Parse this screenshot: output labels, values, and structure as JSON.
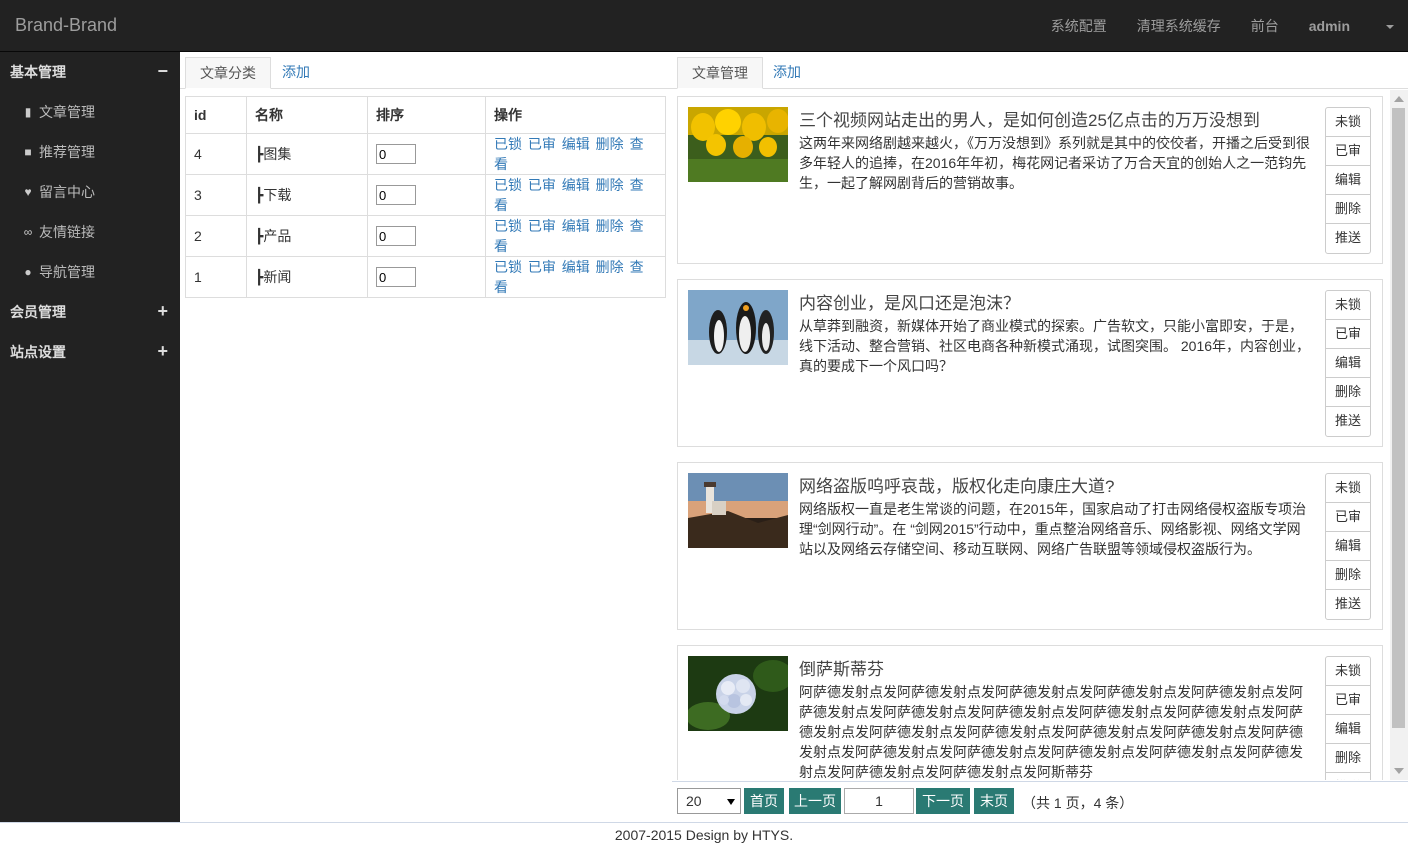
{
  "navbar": {
    "brand": "Brand-Brand",
    "links": [
      "系统配置",
      "清理系统缓存",
      "前台"
    ],
    "user": "admin"
  },
  "sidebar": {
    "groups": [
      {
        "label": "基本管理",
        "toggle": "−"
      },
      {
        "label": "会员管理",
        "toggle": "+"
      },
      {
        "label": "站点设置",
        "toggle": "+"
      }
    ],
    "items": [
      {
        "label": "文章管理",
        "icon": "file-icon"
      },
      {
        "label": "推荐管理",
        "icon": "bookmark-icon"
      },
      {
        "label": "留言中心",
        "icon": "heart-icon"
      },
      {
        "label": "友情链接",
        "icon": "link-icon"
      },
      {
        "label": "导航管理",
        "icon": "globe-icon"
      }
    ]
  },
  "category_panel": {
    "tab": "文章分类",
    "add": "添加",
    "columns": [
      "id",
      "名称",
      "排序",
      "操作"
    ],
    "rows": [
      {
        "id": "4",
        "name": "┣图集",
        "order": "0"
      },
      {
        "id": "3",
        "name": "┣下载",
        "order": "0"
      },
      {
        "id": "2",
        "name": "┣产品",
        "order": "0"
      },
      {
        "id": "1",
        "name": "┣新闻",
        "order": "0"
      }
    ],
    "ops": [
      "已锁",
      "已审",
      "编辑",
      "删除",
      "查看"
    ]
  },
  "article_panel": {
    "tab": "文章管理",
    "add": "添加",
    "buttons": [
      "未锁",
      "已审",
      "编辑",
      "删除",
      "推送"
    ],
    "articles": [
      {
        "title": "三个视频网站走出的男人，是如何创造25亿点击的万万没想到",
        "desc": "这两年来网络剧越来越火，《万万没想到》系列就是其中的佼佼者，开播之后受到很多年轻人的追捧，在2016年年初，梅花网记者采访了万合天宜的创始人之一范钧先生，一起了解网剧背后的营销故事。",
        "image": "tulips"
      },
      {
        "title": "内容创业，是风口还是泡沫？",
        "desc": "从草莽到融资，新媒体开始了商业模式的探索。广告软文，只能小富即安，于是，线下活动、整合营销、社区电商各种新模式涌现，试图突围。 2016年，内容创业，真的要成下一个风口吗？",
        "image": "penguins"
      },
      {
        "title": "网络盗版呜呼哀哉，版权化走向康庄大道?",
        "desc": "网络版权一直是老生常谈的问题，在2015年，国家启动了打击网络侵权盗版专项治理“剑网行动”。在 “剑网2015”行动中，重点整治网络音乐、网络影视、网络文学网站以及网络云存储空间、移动互联网、网络广告联盟等领域侵权盗版行为。",
        "image": "lighthouse"
      },
      {
        "title": "倒萨斯蒂芬",
        "desc": "阿萨德发射点发阿萨德发射点发阿萨德发射点发阿萨德发射点发阿萨德发射点发阿萨德发射点发阿萨德发射点发阿萨德发射点发阿萨德发射点发阿萨德发射点发阿萨德发射点发阿萨德发射点发阿萨德发射点发阿萨德发射点发阿萨德发射点发阿萨德发射点发阿萨德发射点发阿萨德发射点发阿萨德发射点发阿萨德发射点发阿萨德发射点发阿萨德发射点发阿萨德发射点发阿斯蒂芬",
        "image": "hydrangea"
      }
    ]
  },
  "pager": {
    "page_size": "20",
    "first": "首页",
    "prev": "上一页",
    "current": "1",
    "next": "下一页",
    "last": "末页",
    "total": "（共 1 页，4 条）"
  },
  "footer": {
    "text": "2007-2015 Design by HTYS."
  }
}
